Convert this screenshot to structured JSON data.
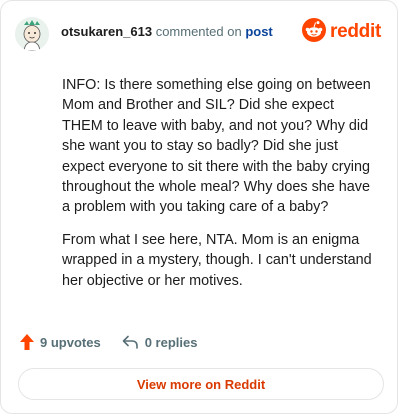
{
  "header": {
    "username": "otsukaren_613",
    "commented_on": "commented on",
    "post_link": "post",
    "brand_name": "reddit",
    "avatar_icon": "user-avatar-icon",
    "brand_icon": "reddit-snoo-icon"
  },
  "comment": {
    "paragraphs": [
      "INFO: Is there something else going on between Mom and Brother and SIL? Did she expect THEM to leave with baby, and not you? Why did she want you to stay so badly? Did she just expect everyone to sit there with the baby crying throughout the whole meal? Why does she have a problem with you taking care of a baby?",
      "From what I see here, NTA. Mom is an enigma wrapped in a mystery, though. I can't understand her objective or her motives."
    ]
  },
  "actions": {
    "upvotes": "9 upvotes",
    "replies": "0 replies",
    "upvote_icon": "upvote-arrow-icon",
    "reply_icon": "reply-arrow-icon"
  },
  "footer": {
    "view_more": "View more on Reddit"
  },
  "colors": {
    "brand": "#ff4500",
    "link": "#0a449b",
    "button_text": "#d93a00",
    "muted": "#576f76"
  }
}
